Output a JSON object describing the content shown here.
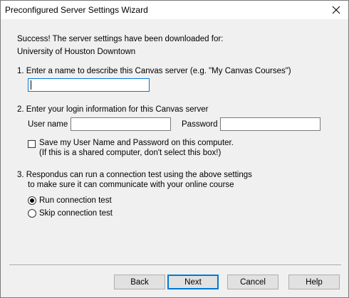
{
  "window": {
    "title": "Preconfigured Server Settings Wizard",
    "close_icon": "close-icon"
  },
  "success": {
    "line1": "Success! The server settings have been downloaded for:",
    "institution": "University of Houston Downtown"
  },
  "step1": {
    "label": "1.  Enter a name to describe this Canvas server (e.g. \"My Canvas Courses\")",
    "server_name_value": ""
  },
  "step2": {
    "label": "2.  Enter your login information for this Canvas server",
    "username_label": "User name",
    "username_value": "",
    "password_label": "Password",
    "password_value": "",
    "save_checkbox_label": "Save my User Name and Password on this computer.",
    "save_checkbox_note": "(If this is a shared computer, don't select this box!)",
    "save_checked": false
  },
  "step3": {
    "label_line1": "3.  Respondus can run a connection test using the above settings",
    "label_line2": "to make sure it can communicate with your online course",
    "options": [
      {
        "label": "Run connection test",
        "selected": true
      },
      {
        "label": "Skip connection test",
        "selected": false
      }
    ]
  },
  "buttons": {
    "back": "Back",
    "next": "Next",
    "cancel": "Cancel",
    "help": "Help"
  },
  "colors": {
    "focus_border": "#0078d7",
    "dialog_bg": "#f0f0f0",
    "button_bg": "#e1e1e1"
  }
}
